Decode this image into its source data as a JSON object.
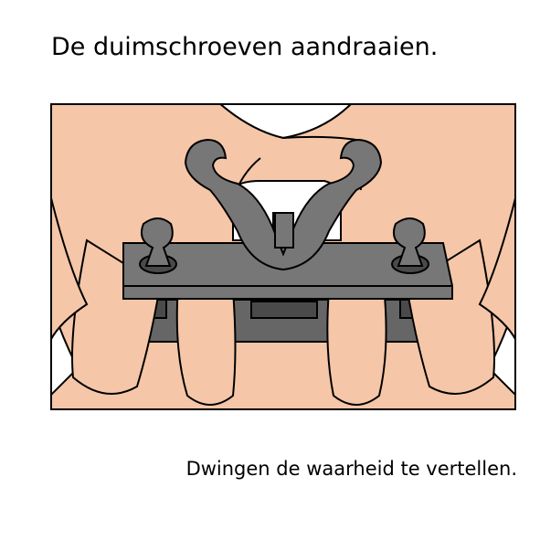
{
  "title": "De duimschroeven aandraaien.",
  "caption": "Dwingen de waarheid te vertellen.",
  "illustration": {
    "icon": "thumbscrew-icon",
    "colors": {
      "skin": "#f5c6a8",
      "metal": "#777777",
      "metal_dark": "#4a4a4a",
      "outline": "#000000",
      "background": "#ffffff"
    }
  }
}
